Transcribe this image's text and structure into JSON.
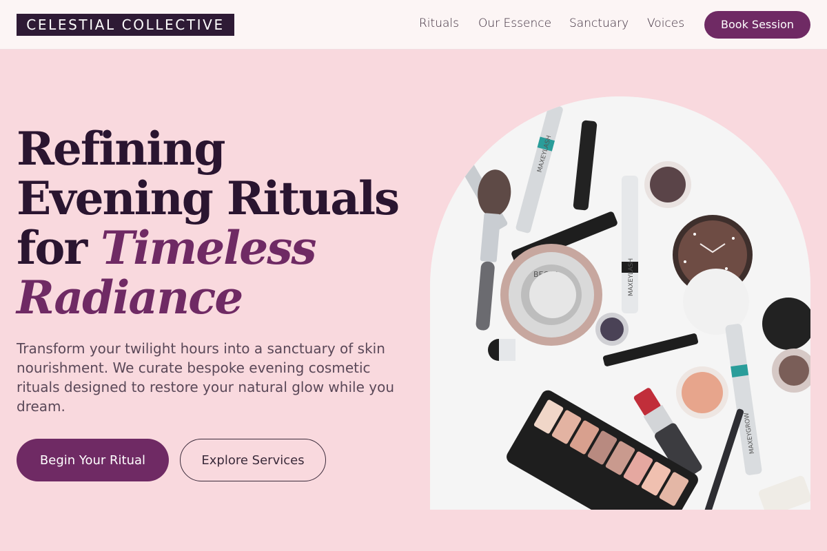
{
  "brand": {
    "name": "CELESTIAL COLLECTIVE"
  },
  "nav": {
    "items": [
      {
        "label": "Rituals"
      },
      {
        "label": "Our Essence"
      },
      {
        "label": "Sanctuary"
      },
      {
        "label": "Voices"
      }
    ],
    "cta_label": "Book Session"
  },
  "hero": {
    "headline_line1": "Refining",
    "headline_line2": "Evening Rituals",
    "headline_line3_plain": "for ",
    "headline_line3_accent": "Timeless",
    "headline_line4_accent": "Radiance",
    "lede": "Transform your twilight hours into a sanctuary of skin nourishment. We curate bespoke evening cosmetic rituals designed to restore your natural glow while you dream.",
    "primary_cta": "Begin Your Ritual",
    "secondary_cta": "Explore Services"
  },
  "product_text": {
    "mascara_1": "MAXEYLASH",
    "mascara_2": "MAXEYLASH",
    "mascara_3": "MAXEYGROW",
    "compact": "BECCA"
  },
  "colors": {
    "accent": "#6f2a64",
    "dark": "#2a1530",
    "page_bg": "#f9d9de",
    "header_bg": "#fcf5f5"
  }
}
